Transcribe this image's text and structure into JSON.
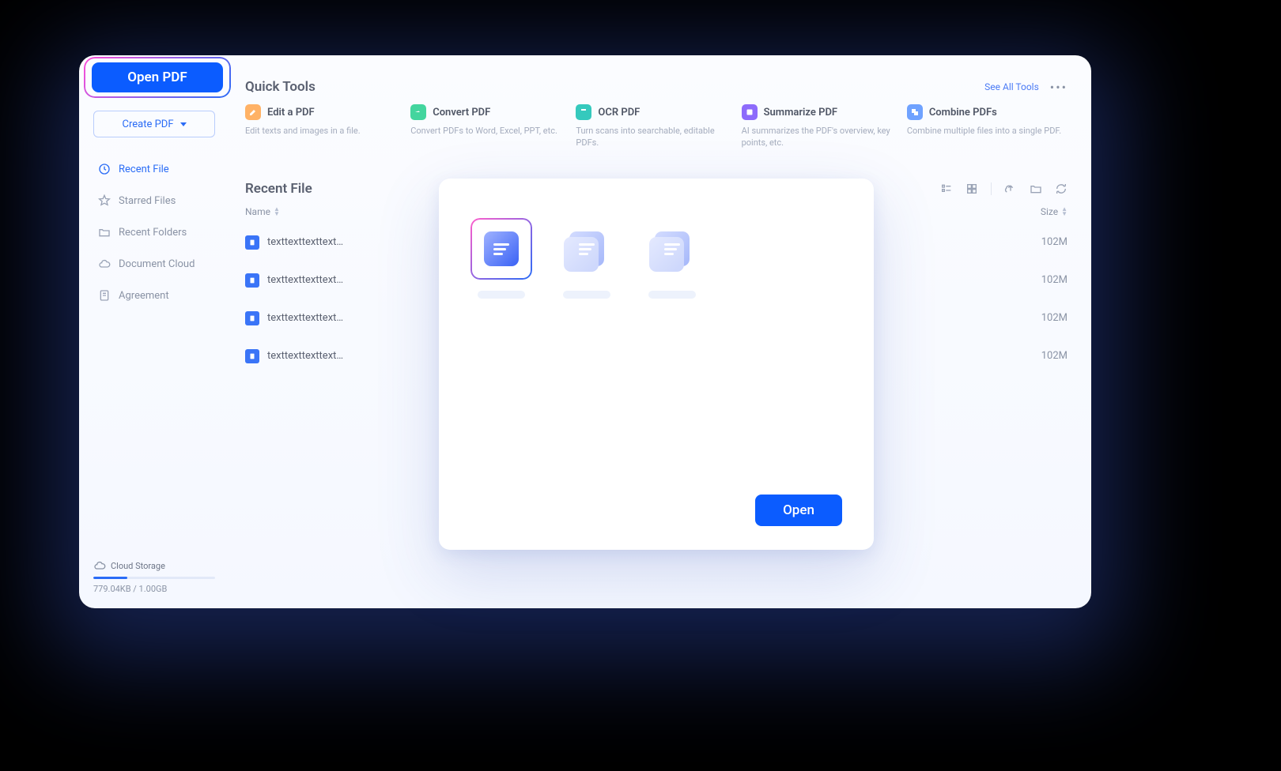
{
  "callout": {
    "open_pdf": "Open PDF"
  },
  "sidebar": {
    "create_pdf": "Create PDF",
    "items": [
      {
        "label": "Recent File"
      },
      {
        "label": "Starred Files"
      },
      {
        "label": "Recent Folders"
      },
      {
        "label": "Document Cloud"
      },
      {
        "label": "Agreement"
      }
    ],
    "cloud_label": "Cloud Storage",
    "cloud_usage": "779.04KB / 1.00GB"
  },
  "quick": {
    "title": "Quick Tools",
    "see_all": "See All Tools",
    "tools": [
      {
        "name": "Edit a PDF",
        "desc": "Edit texts and images in a file.",
        "color": "#ffb266"
      },
      {
        "name": "Convert PDF",
        "desc": "Convert PDFs to Word, Excel, PPT, etc.",
        "color": "#43d59e"
      },
      {
        "name": "OCR PDF",
        "desc": "Turn scans into searchable, editable PDFs.",
        "color": "#35c9bd"
      },
      {
        "name": "Summarize PDF",
        "desc": "AI summarizes the PDF's overview, key points, etc.",
        "color": "#8d6bfb"
      },
      {
        "name": "Combine PDFs",
        "desc": "Combine multiple files into a single PDF.",
        "color": "#6fa2ff"
      }
    ]
  },
  "recent": {
    "title": "Recent File",
    "col_name": "Name",
    "col_size": "Size",
    "rows": [
      {
        "name": "texttexttexttexttext",
        "size": "102M"
      },
      {
        "name": "texttexttexttexttext",
        "size": "102M"
      },
      {
        "name": "texttexttexttexttext",
        "size": "102M"
      },
      {
        "name": "texttexttexttexttext",
        "size": "102M"
      }
    ]
  },
  "dialog": {
    "open": "Open"
  }
}
